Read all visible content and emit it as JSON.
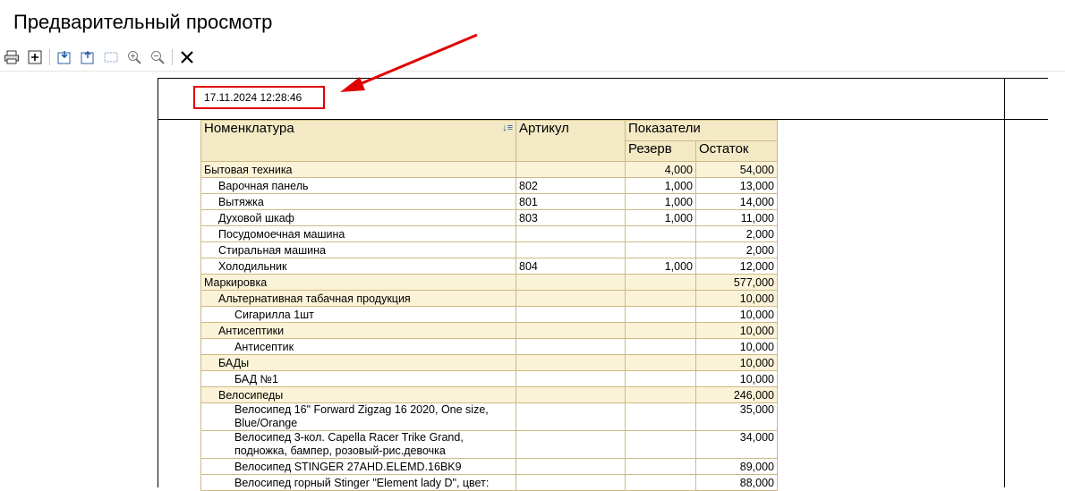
{
  "window": {
    "title": "Предварительный просмотр"
  },
  "toolbar": {
    "icons": [
      "printer-icon",
      "add-icon",
      "export-icon",
      "import-icon",
      "area-select-icon",
      "zoom-in-icon",
      "zoom-out-icon",
      "close-icon"
    ]
  },
  "report": {
    "datetime": "17.11.2024  12:28:46",
    "headers": {
      "nomenclature": "Номенклатура",
      "article": "Артикул",
      "indicators": "Показатели",
      "reserve": "Резерв",
      "balance": "Остаток"
    },
    "rows": [
      {
        "name": "Бытовая техника",
        "article": "",
        "reserve": "4,000",
        "balance": "54,000"
      },
      {
        "name": "Варочная панель",
        "article": "802",
        "reserve": "1,000",
        "balance": "13,000"
      },
      {
        "name": "Вытяжка",
        "article": "801",
        "reserve": "1,000",
        "balance": "14,000"
      },
      {
        "name": "Духовой шкаф",
        "article": "803",
        "reserve": "1,000",
        "balance": "11,000"
      },
      {
        "name": "Посудомоечная машина",
        "article": "",
        "reserve": "",
        "balance": "2,000"
      },
      {
        "name": "Стиральная машина",
        "article": "",
        "reserve": "",
        "balance": "2,000"
      },
      {
        "name": "Холодильник",
        "article": "804",
        "reserve": "1,000",
        "balance": "12,000"
      },
      {
        "name": "Маркировка",
        "article": "",
        "reserve": "",
        "balance": "577,000"
      },
      {
        "name": "Альтернативная табачная продукция",
        "article": "",
        "reserve": "",
        "balance": "10,000"
      },
      {
        "name": "Сигарилла 1шт",
        "article": "",
        "reserve": "",
        "balance": "10,000"
      },
      {
        "name": "Антисептики",
        "article": "",
        "reserve": "",
        "balance": "10,000"
      },
      {
        "name": "Антисептик",
        "article": "",
        "reserve": "",
        "balance": "10,000"
      },
      {
        "name": "БАДы",
        "article": "",
        "reserve": "",
        "balance": "10,000"
      },
      {
        "name": "БАД №1",
        "article": "",
        "reserve": "",
        "balance": "10,000"
      },
      {
        "name": "Велосипеды",
        "article": "",
        "reserve": "",
        "balance": "246,000"
      },
      {
        "name_l1": "Велосипед 16\" Forward Zigzag 16 2020, One size,",
        "name_l2": "Blue/Orange",
        "article": "",
        "reserve": "",
        "balance": "35,000"
      },
      {
        "name_l1": "Велосипед 3-кол. Capella Racer Trike Grand,",
        "name_l2": "подножка, бампер, розовый-рис.девочка",
        "article": "",
        "reserve": "",
        "balance": "34,000"
      },
      {
        "name": "Велосипед STINGER 27AHD.ELEMD.16BK9",
        "article": "",
        "reserve": "",
        "balance": "89,000"
      },
      {
        "name": "Велосипед горный Stinger \"Element lady D\", цвет:",
        "article": "",
        "reserve": "",
        "balance": "88,000"
      }
    ]
  }
}
